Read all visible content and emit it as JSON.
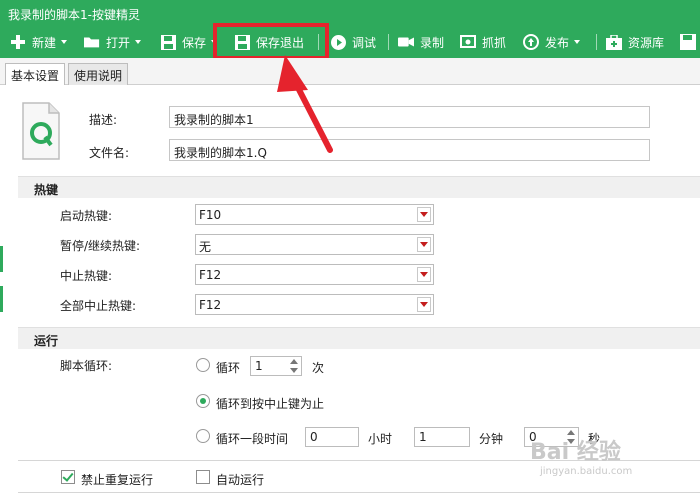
{
  "window": {
    "title": "我录制的脚本1-按键精灵"
  },
  "toolbar": {
    "items": [
      {
        "label": "新建",
        "icon": "plus-icon"
      },
      {
        "label": "打开",
        "icon": "folder-icon"
      },
      {
        "label": "保存",
        "icon": "save-icon"
      },
      {
        "label": "保存退出",
        "icon": "save-exit-icon"
      },
      {
        "label": "调试",
        "icon": "play-icon"
      },
      {
        "label": "录制",
        "icon": "camera-icon"
      },
      {
        "label": "抓抓",
        "icon": "capture-icon"
      },
      {
        "label": "发布",
        "icon": "publish-icon"
      },
      {
        "label": "资源库",
        "icon": "resource-icon"
      }
    ]
  },
  "tabs": [
    {
      "label": "基本设置",
      "active": true
    },
    {
      "label": "使用说明",
      "active": false
    }
  ],
  "script_info": {
    "desc_label": "描述:",
    "desc_value": "我录制的脚本1",
    "filename_label": "文件名:",
    "filename_value": "我录制的脚本1.Q"
  },
  "hotkeys": {
    "header": "热键",
    "rows": [
      {
        "label": "启动热键:",
        "value": "F10"
      },
      {
        "label": "暂停/继续热键:",
        "value": "无"
      },
      {
        "label": "中止热键:",
        "value": "F12"
      },
      {
        "label": "全部中止热键:",
        "value": "F12"
      }
    ]
  },
  "run": {
    "header": "运行",
    "loop_label": "脚本循环:",
    "opt_loop": "循环",
    "loop_count": "1",
    "times_unit": "次",
    "opt_until_stop": "循环到按中止键为止",
    "opt_duration": "循环一段时间",
    "hours_value": "0",
    "hours_unit": "小时",
    "minutes_value": "1",
    "minutes_unit": "分钟",
    "seconds_value": "0",
    "seconds_unit": "秒",
    "selected_option": "until_stop"
  },
  "options": {
    "no_repeat_label": "禁止重复运行",
    "no_repeat_checked": true,
    "auto_run_label": "自动运行",
    "auto_run_checked": false
  },
  "watermark": {
    "text": "Bai 经验",
    "sub": "jingyan.baidu.com"
  },
  "colors": {
    "brand_green": "#2eaa5c",
    "highlight_red": "#e5232d"
  }
}
